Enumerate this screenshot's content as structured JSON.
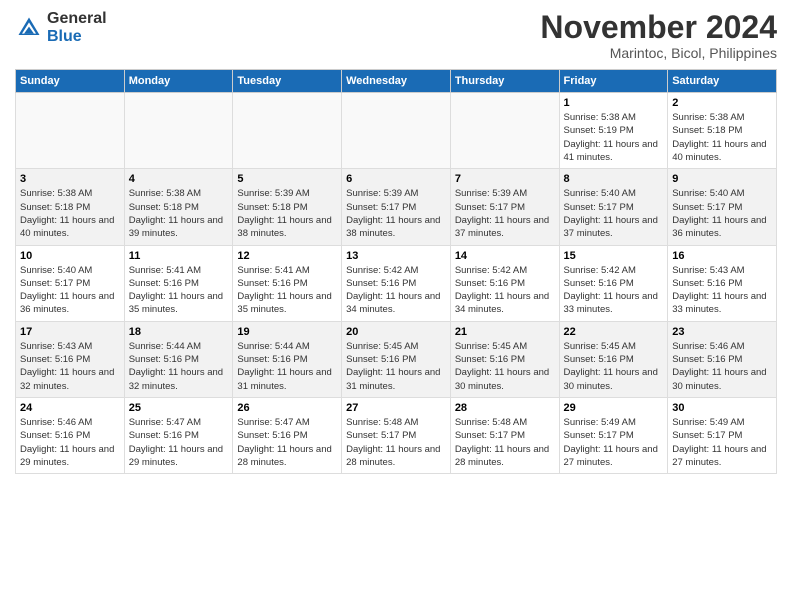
{
  "header": {
    "title": "November 2024",
    "location": "Marintoc, Bicol, Philippines",
    "logo_general": "General",
    "logo_blue": "Blue"
  },
  "weekdays": [
    "Sunday",
    "Monday",
    "Tuesday",
    "Wednesday",
    "Thursday",
    "Friday",
    "Saturday"
  ],
  "weeks": [
    [
      {
        "day": "",
        "info": ""
      },
      {
        "day": "",
        "info": ""
      },
      {
        "day": "",
        "info": ""
      },
      {
        "day": "",
        "info": ""
      },
      {
        "day": "",
        "info": ""
      },
      {
        "day": "1",
        "info": "Sunrise: 5:38 AM\nSunset: 5:19 PM\nDaylight: 11 hours and 41 minutes."
      },
      {
        "day": "2",
        "info": "Sunrise: 5:38 AM\nSunset: 5:18 PM\nDaylight: 11 hours and 40 minutes."
      }
    ],
    [
      {
        "day": "3",
        "info": "Sunrise: 5:38 AM\nSunset: 5:18 PM\nDaylight: 11 hours and 40 minutes."
      },
      {
        "day": "4",
        "info": "Sunrise: 5:38 AM\nSunset: 5:18 PM\nDaylight: 11 hours and 39 minutes."
      },
      {
        "day": "5",
        "info": "Sunrise: 5:39 AM\nSunset: 5:18 PM\nDaylight: 11 hours and 38 minutes."
      },
      {
        "day": "6",
        "info": "Sunrise: 5:39 AM\nSunset: 5:17 PM\nDaylight: 11 hours and 38 minutes."
      },
      {
        "day": "7",
        "info": "Sunrise: 5:39 AM\nSunset: 5:17 PM\nDaylight: 11 hours and 37 minutes."
      },
      {
        "day": "8",
        "info": "Sunrise: 5:40 AM\nSunset: 5:17 PM\nDaylight: 11 hours and 37 minutes."
      },
      {
        "day": "9",
        "info": "Sunrise: 5:40 AM\nSunset: 5:17 PM\nDaylight: 11 hours and 36 minutes."
      }
    ],
    [
      {
        "day": "10",
        "info": "Sunrise: 5:40 AM\nSunset: 5:17 PM\nDaylight: 11 hours and 36 minutes."
      },
      {
        "day": "11",
        "info": "Sunrise: 5:41 AM\nSunset: 5:16 PM\nDaylight: 11 hours and 35 minutes."
      },
      {
        "day": "12",
        "info": "Sunrise: 5:41 AM\nSunset: 5:16 PM\nDaylight: 11 hours and 35 minutes."
      },
      {
        "day": "13",
        "info": "Sunrise: 5:42 AM\nSunset: 5:16 PM\nDaylight: 11 hours and 34 minutes."
      },
      {
        "day": "14",
        "info": "Sunrise: 5:42 AM\nSunset: 5:16 PM\nDaylight: 11 hours and 34 minutes."
      },
      {
        "day": "15",
        "info": "Sunrise: 5:42 AM\nSunset: 5:16 PM\nDaylight: 11 hours and 33 minutes."
      },
      {
        "day": "16",
        "info": "Sunrise: 5:43 AM\nSunset: 5:16 PM\nDaylight: 11 hours and 33 minutes."
      }
    ],
    [
      {
        "day": "17",
        "info": "Sunrise: 5:43 AM\nSunset: 5:16 PM\nDaylight: 11 hours and 32 minutes."
      },
      {
        "day": "18",
        "info": "Sunrise: 5:44 AM\nSunset: 5:16 PM\nDaylight: 11 hours and 32 minutes."
      },
      {
        "day": "19",
        "info": "Sunrise: 5:44 AM\nSunset: 5:16 PM\nDaylight: 11 hours and 31 minutes."
      },
      {
        "day": "20",
        "info": "Sunrise: 5:45 AM\nSunset: 5:16 PM\nDaylight: 11 hours and 31 minutes."
      },
      {
        "day": "21",
        "info": "Sunrise: 5:45 AM\nSunset: 5:16 PM\nDaylight: 11 hours and 30 minutes."
      },
      {
        "day": "22",
        "info": "Sunrise: 5:45 AM\nSunset: 5:16 PM\nDaylight: 11 hours and 30 minutes."
      },
      {
        "day": "23",
        "info": "Sunrise: 5:46 AM\nSunset: 5:16 PM\nDaylight: 11 hours and 30 minutes."
      }
    ],
    [
      {
        "day": "24",
        "info": "Sunrise: 5:46 AM\nSunset: 5:16 PM\nDaylight: 11 hours and 29 minutes."
      },
      {
        "day": "25",
        "info": "Sunrise: 5:47 AM\nSunset: 5:16 PM\nDaylight: 11 hours and 29 minutes."
      },
      {
        "day": "26",
        "info": "Sunrise: 5:47 AM\nSunset: 5:16 PM\nDaylight: 11 hours and 28 minutes."
      },
      {
        "day": "27",
        "info": "Sunrise: 5:48 AM\nSunset: 5:17 PM\nDaylight: 11 hours and 28 minutes."
      },
      {
        "day": "28",
        "info": "Sunrise: 5:48 AM\nSunset: 5:17 PM\nDaylight: 11 hours and 28 minutes."
      },
      {
        "day": "29",
        "info": "Sunrise: 5:49 AM\nSunset: 5:17 PM\nDaylight: 11 hours and 27 minutes."
      },
      {
        "day": "30",
        "info": "Sunrise: 5:49 AM\nSunset: 5:17 PM\nDaylight: 11 hours and 27 minutes."
      }
    ]
  ]
}
